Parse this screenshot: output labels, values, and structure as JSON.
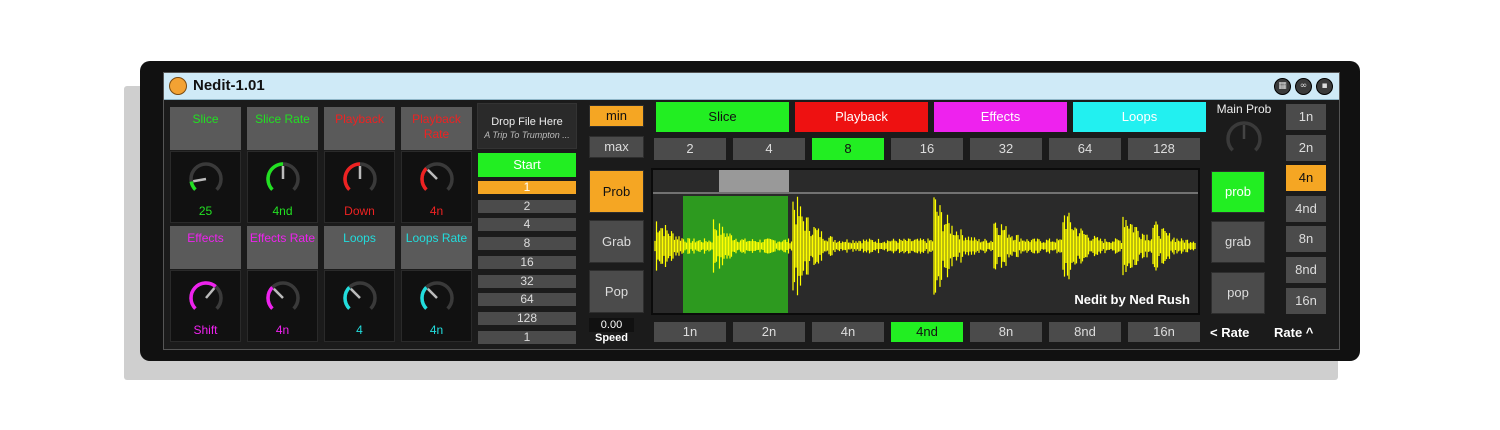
{
  "window": {
    "title": "Nedit-1.01"
  },
  "titlebar_icons": [
    "grid-icon",
    "link-icon",
    "save-icon"
  ],
  "knobs": [
    {
      "name": "knob-slice",
      "label": "Slice",
      "value": "25",
      "color": "#22e022",
      "angle": -100
    },
    {
      "name": "knob-slice-rate",
      "label": "Slice Rate",
      "value": "4nd",
      "color": "#22e022",
      "angle": 0
    },
    {
      "name": "knob-playback",
      "label": "Playback",
      "value": "Down",
      "color": "#ee2222",
      "angle": 0
    },
    {
      "name": "knob-playback-rate",
      "label": "Playback Rate",
      "value": "4n",
      "color": "#ee2222",
      "angle": -45
    },
    {
      "name": "knob-effects",
      "label": "Effects",
      "value": "Shift",
      "color": "#ee22ee",
      "angle": 40
    },
    {
      "name": "knob-effects-rate",
      "label": "Effects Rate",
      "value": "4n",
      "color": "#ee22ee",
      "angle": -45
    },
    {
      "name": "knob-loops",
      "label": "Loops",
      "value": "4",
      "color": "#22dddd",
      "angle": -45
    },
    {
      "name": "knob-loops-rate",
      "label": "Loops Rate",
      "value": "4n",
      "color": "#22dddd",
      "angle": -45
    }
  ],
  "file": {
    "drop_label": "Drop File Here",
    "file_name": "A Trip To Trumpton ...",
    "start_label": "Start"
  },
  "slice_counts": [
    "1",
    "2",
    "4",
    "8",
    "16",
    "32",
    "64",
    "128",
    "1"
  ],
  "slice_counts_selected": 0,
  "left_controls": {
    "min": "min",
    "max": "max",
    "prob": "Prob",
    "grab": "Grab",
    "pop": "Pop",
    "speed_value": "0.00",
    "speed_label": "Speed"
  },
  "tabs": [
    {
      "label": "Slice",
      "bg": "#22ee22",
      "fg": "#111111"
    },
    {
      "label": "Playback",
      "bg": "#ee1111",
      "fg": "#ffffff"
    },
    {
      "label": "Effects",
      "bg": "#ee22ee",
      "fg": "#ffffff"
    },
    {
      "label": "Loops",
      "bg": "#22f0f0",
      "fg": "#ffffff"
    }
  ],
  "top_values": [
    "2",
    "4",
    "8",
    "16",
    "32",
    "64",
    "128"
  ],
  "top_values_selected": 2,
  "bottom_rates": [
    "1n",
    "2n",
    "4n",
    "4nd",
    "8n",
    "8nd",
    "16n"
  ],
  "bottom_rates_selected": 3,
  "waveform": {
    "credit": "Nedit by Ned Rush",
    "color": "#ffff00",
    "selection_color": "#2d9a1f"
  },
  "right_panel": {
    "main_prob": "Main Prob",
    "prob": "prob",
    "grab": "grab",
    "pop": "pop",
    "rate_left": "< Rate",
    "rate_up": "Rate ^"
  },
  "rate_buttons": [
    "1n",
    "2n",
    "4n",
    "4nd",
    "8n",
    "8nd",
    "16n"
  ],
  "rate_buttons_selected": 2
}
